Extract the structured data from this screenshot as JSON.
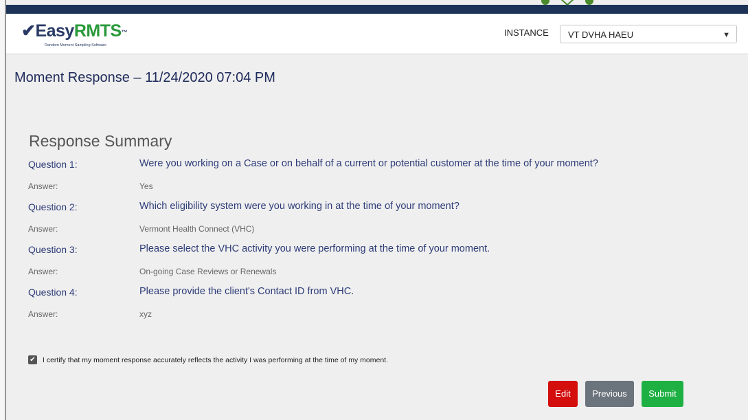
{
  "brand": {
    "mark": "✔",
    "name_part1": "Easy",
    "name_part2": "RMTS",
    "trademark": "™",
    "tagline": "Random Moment Sampling Software"
  },
  "header": {
    "instance_label": "INSTANCE",
    "instance_value": "VT DVHA HAEU",
    "caret": "▼"
  },
  "page": {
    "title": "Moment Response – 11/24/2020 07:04 PM"
  },
  "summary": {
    "title": "Response Summary",
    "items": [
      {
        "question_label": "Question 1:",
        "question": "Were you working on a Case or on behalf of a current or potential customer at the time of your moment?",
        "answer_label": "Answer:",
        "answer": "Yes"
      },
      {
        "question_label": "Question 2:",
        "question": "Which eligibility system were you working in at the time of your moment?",
        "answer_label": "Answer:",
        "answer": "Vermont Health Connect (VHC)"
      },
      {
        "question_label": "Question 3:",
        "question": "Please select the VHC activity you were performing at the time of your moment.",
        "answer_label": "Answer:",
        "answer": "On-going Case Reviews or Renewals"
      },
      {
        "question_label": "Question 4:",
        "question": "Please provide the client's Contact ID from VHC.",
        "answer_label": "Answer:",
        "answer": "xyz"
      }
    ]
  },
  "certify": {
    "checked": true,
    "check_glyph": "✔",
    "text": "I certify that my moment response accurately reflects the activity I was performing at the time of my moment."
  },
  "actions": {
    "edit_label": "Edit",
    "previous_label": "Previous",
    "submit_label": "Submit"
  },
  "colors": {
    "topbar": "#1c3256",
    "brand_navy": "#2a3a66",
    "brand_green": "#2a9a3a",
    "edit_button": "#d40d0d",
    "previous_button": "#6b737c",
    "submit_button": "#1eb043"
  }
}
